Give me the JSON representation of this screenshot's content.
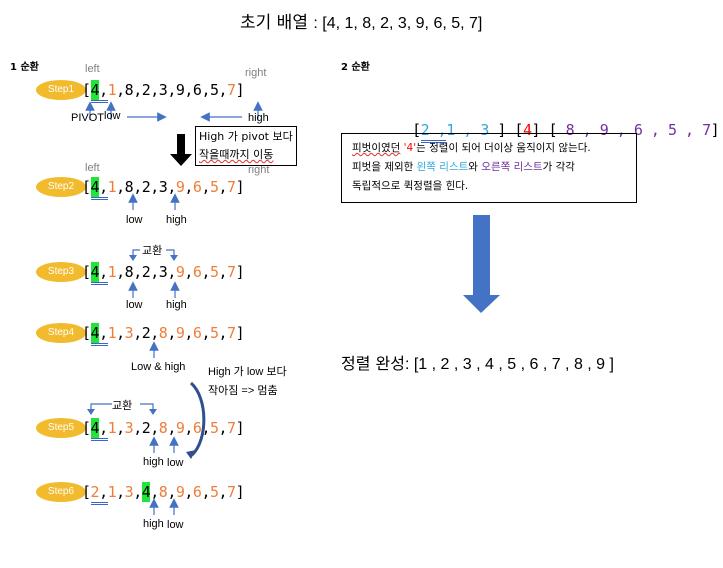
{
  "title": {
    "label": "초기 배열",
    "array": ": [4, 1, 8, 2, 3, 9, 6, 5, 7]"
  },
  "section1": {
    "label": "1 순환",
    "steps": [
      {
        "badge": "Step1",
        "values": [
          "4",
          "1",
          "8",
          "2",
          "3",
          "9",
          "6",
          "5",
          "7"
        ],
        "colors": [
          "black",
          "orange",
          "black",
          "black",
          "black",
          "black",
          "black",
          "black",
          "orange"
        ],
        "highlight": 0,
        "underline": 0
      },
      {
        "badge": "Step2",
        "values": [
          "4",
          "1",
          "8",
          "2",
          "3",
          "9",
          "6",
          "5",
          "7"
        ],
        "colors": [
          "black",
          "orange",
          "black",
          "black",
          "black",
          "orange",
          "orange",
          "orange",
          "orange"
        ],
        "highlight": 0,
        "underline": 0
      },
      {
        "badge": "Step3",
        "values": [
          "4",
          "1",
          "8",
          "2",
          "3",
          "9",
          "6",
          "5",
          "7"
        ],
        "colors": [
          "black",
          "orange",
          "black",
          "black",
          "black",
          "orange",
          "orange",
          "orange",
          "orange"
        ],
        "highlight": 0,
        "underline": 0
      },
      {
        "badge": "Step4",
        "values": [
          "4",
          "1",
          "3",
          "2",
          "8",
          "9",
          "6",
          "5",
          "7"
        ],
        "colors": [
          "black",
          "orange",
          "orange",
          "black",
          "orange",
          "orange",
          "orange",
          "orange",
          "orange"
        ],
        "highlight": 0,
        "underline": 0
      },
      {
        "badge": "Step5",
        "values": [
          "4",
          "1",
          "3",
          "2",
          "8",
          "9",
          "6",
          "5",
          "7"
        ],
        "colors": [
          "black",
          "orange",
          "orange",
          "black",
          "orange",
          "orange",
          "orange",
          "orange",
          "orange"
        ],
        "highlight": 0,
        "underline": 0
      },
      {
        "badge": "Step6",
        "values": [
          "2",
          "1",
          "3",
          "4",
          "8",
          "9",
          "6",
          "5",
          "7"
        ],
        "colors": [
          "orange",
          "orange",
          "orange",
          "black",
          "orange",
          "orange",
          "orange",
          "orange",
          "orange"
        ],
        "highlight": 3,
        "underline": 0
      }
    ],
    "labels": {
      "left": "left",
      "right": "right",
      "pivot": "PIVOT",
      "low": "low",
      "high": "high",
      "low_and_high": "Low & high",
      "swap": "교환"
    },
    "note1": {
      "line1": "High 가 pivot 보다",
      "line2": "작을때까지 이동"
    },
    "note2": {
      "line1": "High 가 low 보다",
      "line2": "작아짐 => 멈춤"
    }
  },
  "section2": {
    "label": "2 순환",
    "left_list": [
      "2",
      "1",
      "3"
    ],
    "pivot": [
      "4"
    ],
    "right_list": [
      "8",
      "9",
      "6",
      "5",
      "7"
    ],
    "description": {
      "line1_a": "피벗이였던",
      "line1_q": "'4'",
      "line1_b": "는 정렬이 되어 더이상 움직이지 않는다.",
      "line2_a": "피벗을 제외한 ",
      "line2_left": "왼쪽 리스트",
      "line2_mid": "와 ",
      "line2_right": "오른쪽 리스트",
      "line2_b": "가 각각",
      "line3": "독립적으로 퀵정렬을 힌다."
    },
    "result_label": "정렬 완성",
    "result_array": ": [1 , 2 , 3 , 4 , 5 , 6 , 7 , 8 , 9 ]"
  },
  "colors": {
    "orange": "#ee7d3a",
    "blue": "#2fa8df",
    "purple": "#7030a0",
    "red": "#ff0000",
    "arrow_blue": "#4472c4",
    "badge": "#f2bb2e",
    "highlight": "#22e53b"
  }
}
